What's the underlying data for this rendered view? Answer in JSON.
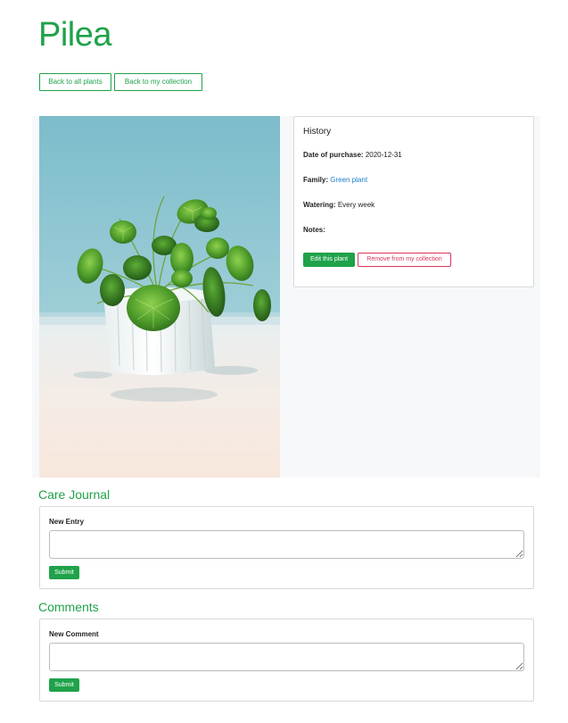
{
  "page": {
    "title": "Pilea"
  },
  "nav": {
    "back_all": "Back to all plants",
    "back_collection": "Back to my collection"
  },
  "history": {
    "title": "History",
    "date_label": "Date of purchase:",
    "date_value": "2020-12-31",
    "family_label": "Family:",
    "family_value": "Green plant",
    "watering_label": "Watering:",
    "watering_value": "Every week",
    "notes_label": "Notes:",
    "notes_value": "",
    "edit_button": "Edit this plant",
    "remove_button": "Remove from my collection"
  },
  "care_journal": {
    "title": "Care Journal",
    "label": "New Entry",
    "value": "",
    "submit": "Submit"
  },
  "comments": {
    "title": "Comments",
    "label": "New Comment",
    "value": "",
    "submit": "Submit"
  },
  "colors": {
    "accent": "#1fa24a",
    "danger": "#d9345a",
    "link": "#1a7fc9"
  }
}
